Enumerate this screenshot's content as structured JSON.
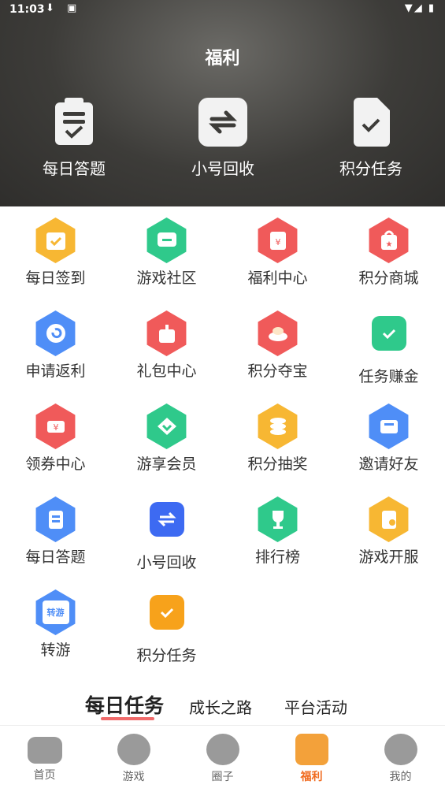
{
  "status": {
    "time": "11:03"
  },
  "header": {
    "title": "福利",
    "items": [
      {
        "label": "每日答题",
        "icon": "clipboard-check-icon"
      },
      {
        "label": "小号回收",
        "icon": "swap-arrows-icon"
      },
      {
        "label": "积分任务",
        "icon": "document-check-icon"
      }
    ]
  },
  "grid": [
    {
      "label": "每日签到",
      "icon": "calendar-check-icon",
      "color": "#f7b733"
    },
    {
      "label": "游戏社区",
      "icon": "chat-bubble-icon",
      "color": "#2fc98b"
    },
    {
      "label": "福利中心",
      "icon": "red-envelope-icon",
      "color": "#f05a5a"
    },
    {
      "label": "积分商城",
      "icon": "shopping-bag-icon",
      "color": "#f05a5a"
    },
    {
      "label": "申请返利",
      "icon": "refresh-icon",
      "color": "#4f8ef7"
    },
    {
      "label": "礼包中心",
      "icon": "gift-box-icon",
      "color": "#f05a5a"
    },
    {
      "label": "积分夺宝",
      "icon": "treasure-ingot-icon",
      "color": "#f05a5a"
    },
    {
      "label": "任务赚金",
      "icon": "clipboard-task-icon",
      "color": "#2fc98b"
    },
    {
      "label": "领券中心",
      "icon": "coupon-icon",
      "color": "#f05a5a"
    },
    {
      "label": "游享会员",
      "icon": "diamond-icon",
      "color": "#2fc98b"
    },
    {
      "label": "积分抽奖",
      "icon": "coin-stack-icon",
      "color": "#f7b733"
    },
    {
      "label": "邀请好友",
      "icon": "mail-invite-icon",
      "color": "#4f8ef7"
    },
    {
      "label": "每日答题",
      "icon": "quiz-clipboard-icon",
      "color": "#4f8ef7"
    },
    {
      "label": "小号回收",
      "icon": "swap-arrows-icon",
      "color": "#3d6af2"
    },
    {
      "label": "排行榜",
      "icon": "trophy-icon",
      "color": "#2fc98b"
    },
    {
      "label": "游戏开服",
      "icon": "server-open-icon",
      "color": "#f7b733"
    },
    {
      "label": "转游",
      "icon": "transfer-game-icon",
      "color": "#4f8ef7",
      "badge": "转游"
    },
    {
      "label": "积分任务",
      "icon": "document-check-icon",
      "color": "#f7a21b"
    }
  ],
  "tabs": [
    {
      "label": "每日任务",
      "active": true
    },
    {
      "label": "成长之路",
      "active": false
    },
    {
      "label": "平台活动",
      "active": false
    }
  ],
  "nav": [
    {
      "label": "首页",
      "icon": "gamepad-icon",
      "active": false
    },
    {
      "label": "游戏",
      "icon": "heart-search-icon",
      "active": false
    },
    {
      "label": "圈子",
      "icon": "community-bubble-icon",
      "active": false
    },
    {
      "label": "福利",
      "icon": "gift-icon",
      "active": true
    },
    {
      "label": "我的",
      "icon": "sunglasses-face-icon",
      "active": false
    }
  ]
}
